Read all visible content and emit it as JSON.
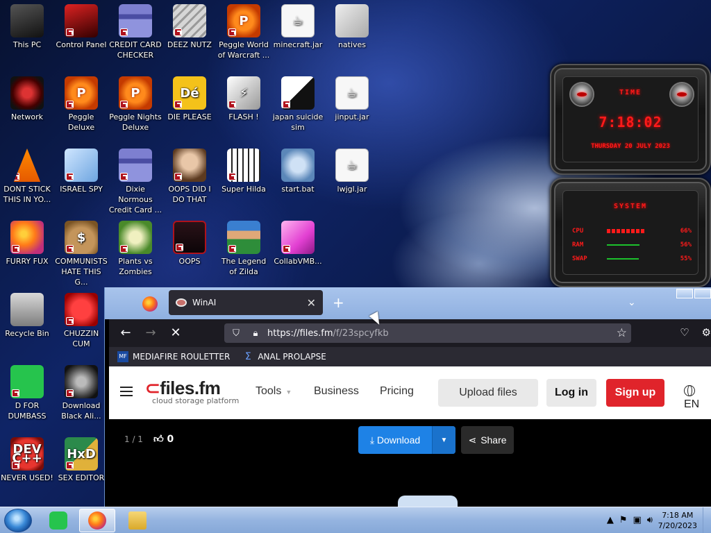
{
  "desktop": {
    "icons": [
      {
        "label": "This PC",
        "icon": "computer-icon"
      },
      {
        "label": "Control Panel",
        "icon": "control-panel-icon"
      },
      {
        "label": "CREDIT CARD CHECKER",
        "icon": "credit-card-icon"
      },
      {
        "label": "DEEZ NUTZ",
        "icon": "stacked-windows-icon"
      },
      {
        "label": "Peggle World of Warcraft ...",
        "icon": "peggle-icon"
      },
      {
        "label": "minecraft.jar",
        "icon": "java-jar-icon"
      },
      {
        "label": "natives",
        "icon": "folder-icon"
      },
      {
        "label": "Network",
        "icon": "network-icon"
      },
      {
        "label": "Peggle Deluxe",
        "icon": "peggle-icon"
      },
      {
        "label": "Peggle Nights Deluxe",
        "icon": "peggle-nights-icon"
      },
      {
        "label": "DIE PLEASE",
        "icon": "de-icon"
      },
      {
        "label": "FLASH !",
        "icon": "flash-icon"
      },
      {
        "label": "japan suicide sim",
        "icon": "japan-sim-icon"
      },
      {
        "label": "jinput.jar",
        "icon": "java-jar-icon"
      },
      {
        "label": "DONT STICK THIS IN YO...",
        "icon": "traffic-cone-icon"
      },
      {
        "label": "ISRAEL SPY",
        "icon": "network-spy-icon"
      },
      {
        "label": "Dixie Normous Credit Card ...",
        "icon": "credit-card-icon"
      },
      {
        "label": "OOPS DID I DO THAT",
        "icon": "portrait-icon"
      },
      {
        "label": "Super Hilda",
        "icon": "pixel-game-icon"
      },
      {
        "label": "start.bat",
        "icon": "gear-icon"
      },
      {
        "label": "lwjgl.jar",
        "icon": "java-jar-icon"
      },
      {
        "label": "FURRY FUX",
        "icon": "firefox-icon"
      },
      {
        "label": "COMMUNISTS HATE THIS G...",
        "icon": "money-bag-icon"
      },
      {
        "label": "Plants vs Zombies",
        "icon": "plant-icon"
      },
      {
        "label": "OOPS",
        "icon": "oops-icon"
      },
      {
        "label": "The Legend of Zilda",
        "icon": "zelda-icon"
      },
      {
        "label": "CollabVMB...",
        "icon": "monitor-icon"
      },
      {
        "label": "Recycle Bin",
        "icon": "recycle-bin-icon"
      },
      {
        "label": "CHUZZIN CUM",
        "icon": "chuzzle-icon"
      },
      {
        "label": "D FOR DUMBASS",
        "icon": "green-chat-icon"
      },
      {
        "label": "Download Black Ali...",
        "icon": "alien-icon"
      },
      {
        "label": "NEVER USED!",
        "icon": "dev-cpp-icon"
      },
      {
        "label": "SEX EDITOR",
        "icon": "hxd-icon"
      }
    ]
  },
  "gadgets": {
    "time": {
      "title": "TIME",
      "clock": "7:18:02",
      "date": "THURSDAY 20 JULY 2023"
    },
    "system": {
      "title": "SYSTEM",
      "rows": [
        {
          "label": "CPU",
          "value": 0.66,
          "pct": "66%"
        },
        {
          "label": "RAM",
          "value": 0.56,
          "pct": "56%"
        },
        {
          "label": "SWAP",
          "value": 0.55,
          "pct": "55%"
        }
      ]
    }
  },
  "browser": {
    "tab_title": "WinAI",
    "url_host": "https://files.fm",
    "url_path": "/f/23spcyfkb",
    "bookmarks": [
      {
        "label": "MEDIAFIRE ROULETTER",
        "icon": "mediafire-icon"
      },
      {
        "label": "ANAL PROLAPSE",
        "icon": "sigma-icon"
      }
    ],
    "site": {
      "logo_main": "files.fm",
      "logo_sub": "cloud storage platform",
      "nav": [
        "Tools",
        "Business",
        "Pricing"
      ],
      "upload_label": "Upload files",
      "login_label": "Log in",
      "signup_label": "Sign up",
      "lang": "EN"
    },
    "content": {
      "pager": "1 / 1",
      "likes": "0",
      "download_label": "Download",
      "share_label": "Share"
    }
  },
  "taskbar": {
    "time": "7:18 AM",
    "date": "7/20/2023"
  }
}
